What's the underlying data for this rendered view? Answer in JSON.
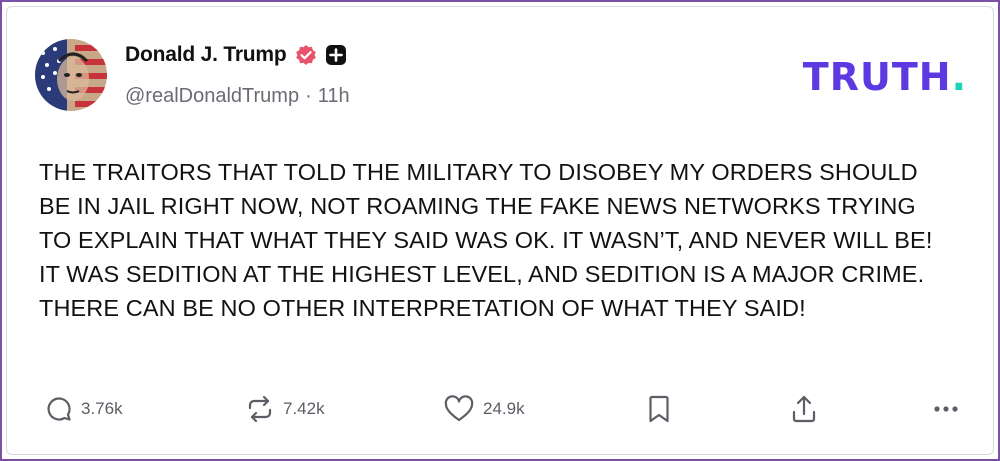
{
  "author": {
    "display_name": "Donald J. Trump",
    "handle": "@realDonaldTrump",
    "separator": "·",
    "time_ago": "11h",
    "avatar": "avatar-american-flag-portrait",
    "badges": [
      "verified-badge-icon",
      "plus-badge-icon"
    ]
  },
  "brand": {
    "logo_text": "TRUTH",
    "logo_dot": ".",
    "color": "#5c39e0",
    "dot_color": "#19d4b5"
  },
  "post": {
    "text": "THE TRAITORS THAT TOLD THE MILITARY TO DISOBEY MY ORDERS SHOULD BE IN JAIL RIGHT NOW, NOT ROAMING THE FAKE NEWS NETWORKS TRYING TO EXPLAIN THAT WHAT THEY SAID WAS OK. IT WASN’T, AND NEVER WILL BE! IT WAS SEDITION AT THE HIGHEST LEVEL, AND SEDITION IS A MAJOR CRIME. THERE CAN BE NO OTHER INTERPRETATION OF WHAT THEY SAID!"
  },
  "actions": {
    "replies": "3.76k",
    "retruths": "7.42k",
    "likes": "24.9k",
    "icons": [
      "reply-icon",
      "retruth-icon",
      "heart-icon",
      "bookmark-icon",
      "share-icon",
      "more-icon"
    ]
  },
  "colors": {
    "frame_border": "#7c4fa6",
    "text": "#121212",
    "muted": "#6b6b73",
    "verified": "#e8526a"
  }
}
